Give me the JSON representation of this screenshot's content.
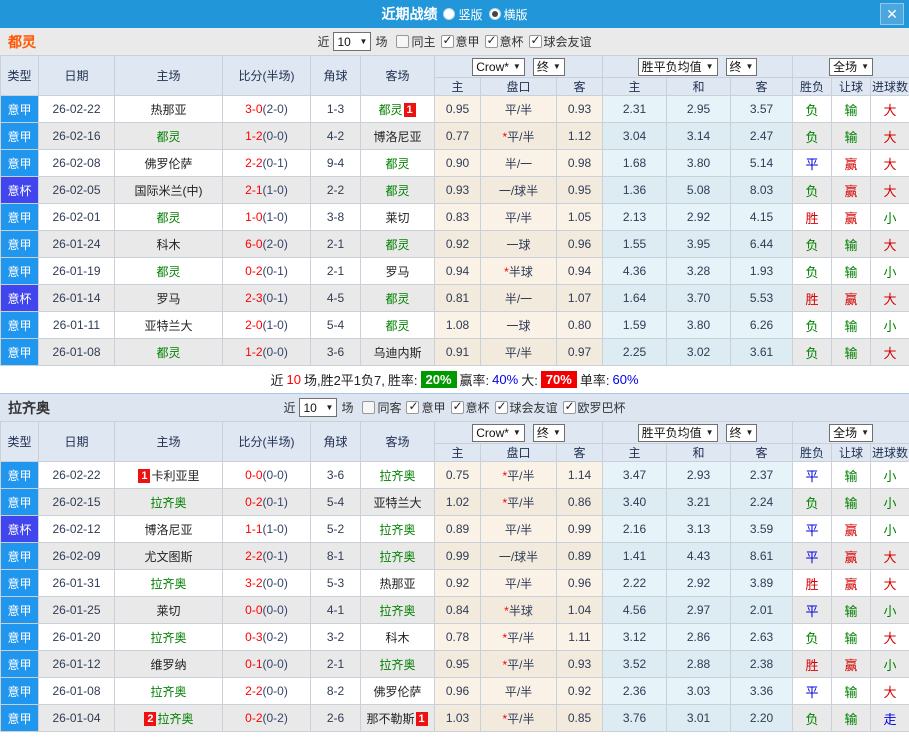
{
  "titlebar": {
    "title": "近期战绩",
    "radios": [
      {
        "label": "竖版",
        "selected": false
      },
      {
        "label": "横版",
        "selected": true
      }
    ],
    "close_glyph": "✕"
  },
  "table_header": {
    "cols": [
      "类型",
      "日期",
      "主场",
      "比分(半场)",
      "角球",
      "客场"
    ],
    "dropdown_crow": "Crow*",
    "dropdown_final": "终",
    "dropdown_avg": "胜平负均值",
    "dropdown_full": "全场",
    "arrow": "▼",
    "sub_cols": [
      "主",
      "盘口",
      "客",
      "主",
      "和",
      "客",
      "胜负",
      "让球",
      "进球数"
    ]
  },
  "colors": {
    "titlebar_blue": "#2196d8",
    "league_serie_a": "#2196ef",
    "league_coppa": "#4145ee",
    "tracked_team_green": "#008000",
    "score_red": "#ff0000",
    "halftime_navy": "#36456b",
    "result_win_red": "#d40000",
    "result_lose_green": "#008000",
    "result_draw_blue": "#0000dd",
    "crow_col_bg": "#faf2e6",
    "avg_col_bg": "#e6f3f9",
    "badge_red": "#ee1111"
  },
  "sections": [
    {
      "team": "都灵",
      "team_color": "#ff5500",
      "filters": {
        "near_label": "近",
        "count": "10",
        "games_label": "场",
        "checkboxes": [
          {
            "label": "同主",
            "checked": false
          },
          {
            "label": "意甲",
            "checked": true
          },
          {
            "label": "意杯",
            "checked": true
          },
          {
            "label": "球会友谊",
            "checked": true
          }
        ]
      },
      "rows": [
        {
          "type": "意甲",
          "date": "26-02-22",
          "home": "热那亚",
          "score_ft": "3-0",
          "score_ht": "(2-0)",
          "corner": "1-3",
          "away": "都灵",
          "away_badge": "1",
          "odds_home": "0.95",
          "handicap_line": "平/半",
          "odds_away": "0.93",
          "avg_home": "2.31",
          "avg_draw": "2.95",
          "avg_away": "3.57",
          "result": "负",
          "handicap_result": "输",
          "goals_result": "大"
        },
        {
          "type": "意甲",
          "date": "26-02-16",
          "home": "都灵",
          "score_ft": "1-2",
          "score_ht": "(0-0)",
          "corner": "4-2",
          "away": "博洛尼亚",
          "odds_home": "0.77",
          "handicap_line": "*平/半",
          "odds_away": "1.12",
          "avg_home": "3.04",
          "avg_draw": "3.14",
          "avg_away": "2.47",
          "result": "负",
          "handicap_result": "输",
          "goals_result": "大"
        },
        {
          "type": "意甲",
          "date": "26-02-08",
          "home": "佛罗伦萨",
          "score_ft": "2-2",
          "score_ht": "(0-1)",
          "corner": "9-4",
          "away": "都灵",
          "odds_home": "0.90",
          "handicap_line": "半/一",
          "odds_away": "0.98",
          "avg_home": "1.68",
          "avg_draw": "3.80",
          "avg_away": "5.14",
          "result": "平",
          "handicap_result": "赢",
          "goals_result": "大"
        },
        {
          "type": "意杯",
          "date": "26-02-05",
          "home": "国际米兰(中)",
          "score_ft": "2-1",
          "score_ht": "(1-0)",
          "corner": "2-2",
          "away": "都灵",
          "odds_home": "0.93",
          "handicap_line": "一/球半",
          "odds_away": "0.95",
          "avg_home": "1.36",
          "avg_draw": "5.08",
          "avg_away": "8.03",
          "result": "负",
          "handicap_result": "赢",
          "goals_result": "大"
        },
        {
          "type": "意甲",
          "date": "26-02-01",
          "home": "都灵",
          "score_ft": "1-0",
          "score_ht": "(1-0)",
          "corner": "3-8",
          "away": "莱切",
          "odds_home": "0.83",
          "handicap_line": "平/半",
          "odds_away": "1.05",
          "avg_home": "2.13",
          "avg_draw": "2.92",
          "avg_away": "4.15",
          "result": "胜",
          "handicap_result": "赢",
          "goals_result": "小"
        },
        {
          "type": "意甲",
          "date": "26-01-24",
          "home": "科木",
          "score_ft": "6-0",
          "score_ht": "(2-0)",
          "corner": "2-1",
          "away": "都灵",
          "odds_home": "0.92",
          "handicap_line": "一球",
          "odds_away": "0.96",
          "avg_home": "1.55",
          "avg_draw": "3.95",
          "avg_away": "6.44",
          "result": "负",
          "handicap_result": "输",
          "goals_result": "大"
        },
        {
          "type": "意甲",
          "date": "26-01-19",
          "home": "都灵",
          "score_ft": "0-2",
          "score_ht": "(0-1)",
          "corner": "2-1",
          "away": "罗马",
          "odds_home": "0.94",
          "handicap_line": "*半球",
          "odds_away": "0.94",
          "avg_home": "4.36",
          "avg_draw": "3.28",
          "avg_away": "1.93",
          "result": "负",
          "handicap_result": "输",
          "goals_result": "小"
        },
        {
          "type": "意杯",
          "date": "26-01-14",
          "home": "罗马",
          "score_ft": "2-3",
          "score_ht": "(0-1)",
          "corner": "4-5",
          "away": "都灵",
          "odds_home": "0.81",
          "handicap_line": "半/一",
          "odds_away": "1.07",
          "avg_home": "1.64",
          "avg_draw": "3.70",
          "avg_away": "5.53",
          "result": "胜",
          "handicap_result": "赢",
          "goals_result": "大"
        },
        {
          "type": "意甲",
          "date": "26-01-11",
          "home": "亚特兰大",
          "score_ft": "2-0",
          "score_ht": "(1-0)",
          "corner": "5-4",
          "away": "都灵",
          "odds_home": "1.08",
          "handicap_line": "一球",
          "odds_away": "0.80",
          "avg_home": "1.59",
          "avg_draw": "3.80",
          "avg_away": "6.26",
          "result": "负",
          "handicap_result": "输",
          "goals_result": "小"
        },
        {
          "type": "意甲",
          "date": "26-01-08",
          "home": "都灵",
          "score_ft": "1-2",
          "score_ht": "(0-0)",
          "corner": "3-6",
          "away": "乌迪内斯",
          "odds_home": "0.91",
          "handicap_line": "平/半",
          "odds_away": "0.97",
          "avg_home": "2.25",
          "avg_draw": "3.02",
          "avg_away": "3.61",
          "result": "负",
          "handicap_result": "输",
          "goals_result": "大"
        }
      ],
      "summary": {
        "prefix": "近",
        "count": "10",
        "record_text": "场,胜2平1负7,",
        "win_rate_label": "胜率:",
        "win_rate": "20%",
        "profit_rate_label": "赢率:",
        "profit_rate": "40%",
        "big_label": "大:",
        "big_rate": "70%",
        "single_label": "单率:",
        "single_rate": "60%"
      }
    },
    {
      "team": "拉齐奥",
      "team_color": "#333333",
      "filters": {
        "near_label": "近",
        "count": "10",
        "games_label": "场",
        "checkboxes": [
          {
            "label": "同客",
            "checked": false
          },
          {
            "label": "意甲",
            "checked": true
          },
          {
            "label": "意杯",
            "checked": true
          },
          {
            "label": "球会友谊",
            "checked": true
          },
          {
            "label": "欧罗巴杯",
            "checked": true
          }
        ]
      },
      "rows": [
        {
          "type": "意甲",
          "date": "26-02-22",
          "home": "卡利亚里",
          "home_badge": "1",
          "score_ft": "0-0",
          "score_ht": "(0-0)",
          "corner": "3-6",
          "away": "拉齐奥",
          "odds_home": "0.75",
          "handicap_line": "*平/半",
          "odds_away": "1.14",
          "avg_home": "3.47",
          "avg_draw": "2.93",
          "avg_away": "2.37",
          "result": "平",
          "handicap_result": "输",
          "goals_result": "小"
        },
        {
          "type": "意甲",
          "date": "26-02-15",
          "home": "拉齐奥",
          "score_ft": "0-2",
          "score_ht": "(0-1)",
          "corner": "5-4",
          "away": "亚特兰大",
          "odds_home": "1.02",
          "handicap_line": "*平/半",
          "odds_away": "0.86",
          "avg_home": "3.40",
          "avg_draw": "3.21",
          "avg_away": "2.24",
          "result": "负",
          "handicap_result": "输",
          "goals_result": "小"
        },
        {
          "type": "意杯",
          "date": "26-02-12",
          "home": "博洛尼亚",
          "score_ft": "1-1",
          "score_ht": "(1-0)",
          "corner": "5-2",
          "away": "拉齐奥",
          "odds_home": "0.89",
          "handicap_line": "平/半",
          "odds_away": "0.99",
          "avg_home": "2.16",
          "avg_draw": "3.13",
          "avg_away": "3.59",
          "result": "平",
          "handicap_result": "赢",
          "goals_result": "小"
        },
        {
          "type": "意甲",
          "date": "26-02-09",
          "home": "尤文图斯",
          "score_ft": "2-2",
          "score_ht": "(0-1)",
          "corner": "8-1",
          "away": "拉齐奥",
          "odds_home": "0.99",
          "handicap_line": "一/球半",
          "odds_away": "0.89",
          "avg_home": "1.41",
          "avg_draw": "4.43",
          "avg_away": "8.61",
          "result": "平",
          "handicap_result": "赢",
          "goals_result": "大"
        },
        {
          "type": "意甲",
          "date": "26-01-31",
          "home": "拉齐奥",
          "score_ft": "3-2",
          "score_ht": "(0-0)",
          "corner": "5-3",
          "away": "热那亚",
          "odds_home": "0.92",
          "handicap_line": "平/半",
          "odds_away": "0.96",
          "avg_home": "2.22",
          "avg_draw": "2.92",
          "avg_away": "3.89",
          "result": "胜",
          "handicap_result": "赢",
          "goals_result": "大"
        },
        {
          "type": "意甲",
          "date": "26-01-25",
          "home": "莱切",
          "score_ft": "0-0",
          "score_ht": "(0-0)",
          "corner": "4-1",
          "away": "拉齐奥",
          "odds_home": "0.84",
          "handicap_line": "*半球",
          "odds_away": "1.04",
          "avg_home": "4.56",
          "avg_draw": "2.97",
          "avg_away": "2.01",
          "result": "平",
          "handicap_result": "输",
          "goals_result": "小"
        },
        {
          "type": "意甲",
          "date": "26-01-20",
          "home": "拉齐奥",
          "score_ft": "0-3",
          "score_ht": "(0-2)",
          "corner": "3-2",
          "away": "科木",
          "odds_home": "0.78",
          "handicap_line": "*平/半",
          "odds_away": "1.11",
          "avg_home": "3.12",
          "avg_draw": "2.86",
          "avg_away": "2.63",
          "result": "负",
          "handicap_result": "输",
          "goals_result": "大"
        },
        {
          "type": "意甲",
          "date": "26-01-12",
          "home": "维罗纳",
          "score_ft": "0-1",
          "score_ht": "(0-0)",
          "corner": "2-1",
          "away": "拉齐奥",
          "odds_home": "0.95",
          "handicap_line": "*平/半",
          "odds_away": "0.93",
          "avg_home": "3.52",
          "avg_draw": "2.88",
          "avg_away": "2.38",
          "result": "胜",
          "handicap_result": "赢",
          "goals_result": "小"
        },
        {
          "type": "意甲",
          "date": "26-01-08",
          "home": "拉齐奥",
          "score_ft": "2-2",
          "score_ht": "(0-0)",
          "corner": "8-2",
          "away": "佛罗伦萨",
          "odds_home": "0.96",
          "handicap_line": "平/半",
          "odds_away": "0.92",
          "avg_home": "2.36",
          "avg_draw": "3.03",
          "avg_away": "3.36",
          "result": "平",
          "handicap_result": "输",
          "goals_result": "大"
        },
        {
          "type": "意甲",
          "date": "26-01-04",
          "home": "拉齐奥",
          "home_badge": "2",
          "score_ft": "0-2",
          "score_ht": "(0-2)",
          "corner": "2-6",
          "away": "那不勒斯",
          "away_badge": "1",
          "odds_home": "1.03",
          "handicap_line": "*平/半",
          "odds_away": "0.85",
          "avg_home": "3.76",
          "avg_draw": "3.01",
          "avg_away": "2.20",
          "result": "负",
          "handicap_result": "输",
          "goals_result": "走"
        }
      ]
    }
  ]
}
